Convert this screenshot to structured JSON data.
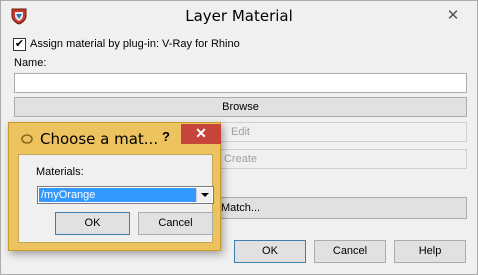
{
  "window": {
    "title": "Layer Material",
    "close_label": "✕"
  },
  "assign": {
    "checked": true,
    "check_glyph": "✔",
    "label": "Assign material by plug-in: V-Ray for Rhino"
  },
  "name_field": {
    "label": "Name:",
    "value": ""
  },
  "buttons": {
    "browse": "Browse",
    "edit": "Edit",
    "create": "Create",
    "match": "Match...",
    "ok": "OK",
    "cancel": "Cancel",
    "help": "Help"
  },
  "popup": {
    "title": "Choose a mat...",
    "help_label": "?",
    "close_label": "✕",
    "materials_label": "Materials:",
    "selected_material": "/myOrange",
    "ok": "OK",
    "cancel": "Cancel"
  },
  "colors": {
    "popup_frame": "#ecc35f",
    "close_red": "#c7443b",
    "selection_blue": "#3399ff"
  }
}
